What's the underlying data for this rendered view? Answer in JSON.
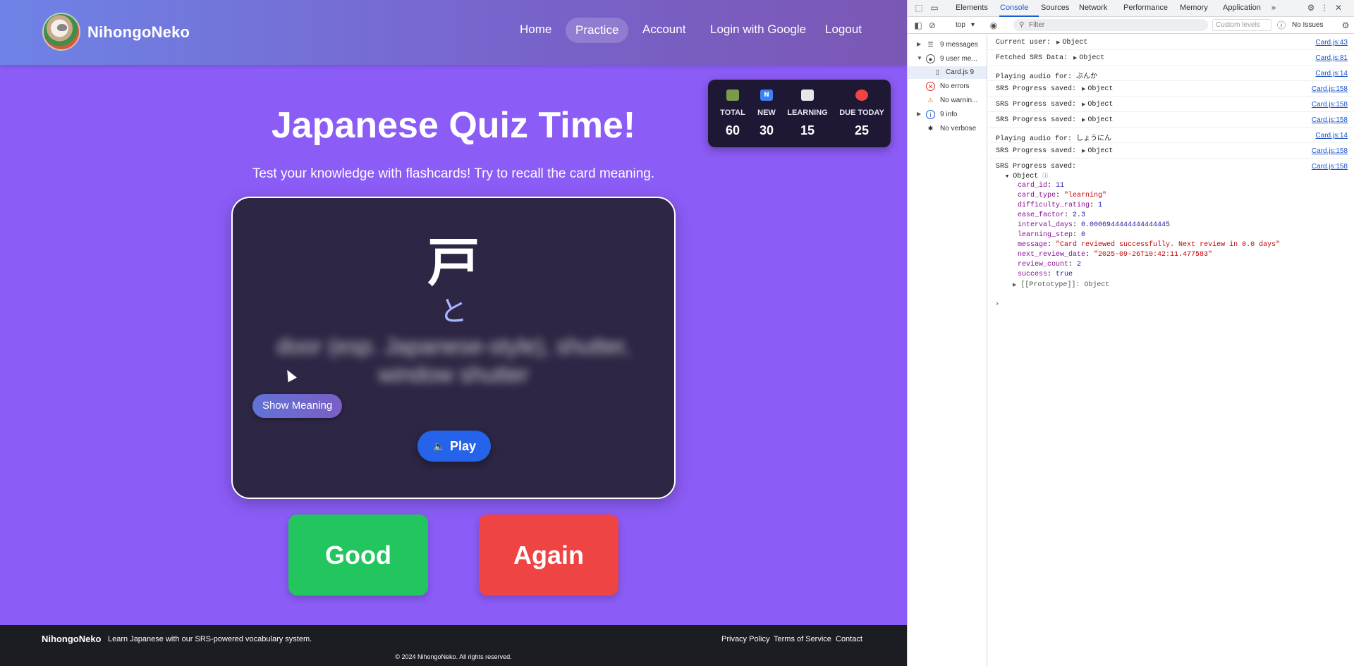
{
  "app": {
    "brand": "NihongoNeko",
    "nav": [
      "Home",
      "Practice",
      "Account",
      "Login with Google",
      "Logout"
    ],
    "active_nav": "Practice",
    "title": "Japanese Quiz Time!",
    "subtitle": "Test your knowledge with flashcards! Try to recall the card meaning.",
    "stats": [
      {
        "label": "TOTAL",
        "value": "60",
        "icon": "books-icon",
        "color": "#7c9b4a"
      },
      {
        "label": "NEW",
        "value": "30",
        "icon": "new-badge-icon",
        "color": "#3b82f6"
      },
      {
        "label": "LEARNING",
        "value": "15",
        "icon": "open-book-icon",
        "color": "#e5e7eb"
      },
      {
        "label": "DUE TODAY",
        "value": "25",
        "icon": "alarm-clock-icon",
        "color": "#ef4444"
      }
    ],
    "card": {
      "kanji": "戸",
      "kana": "と",
      "meaning": "door (esp. Japanese-style), shutter, window shutter",
      "show_meaning_label": "Show Meaning",
      "play_label": "Play"
    },
    "buttons": {
      "good": "Good",
      "again": "Again"
    },
    "colors": {
      "background": "#8b5cf6",
      "good": "#22c55e",
      "again": "#ef4444",
      "play": "#2563eb",
      "card": "#2d2644"
    },
    "footer": {
      "brand": "NihongoNeko",
      "tagline": "Learn Japanese with our SRS-powered vocabulary system.",
      "links": [
        "Privacy Policy",
        "Terms of Service",
        "Contact"
      ],
      "copyright": "© 2024 NihongoNeko. All rights reserved."
    }
  },
  "devtools": {
    "tabs": [
      "Elements",
      "Console",
      "Sources",
      "Network",
      "Performance",
      "Memory",
      "Application"
    ],
    "active_tab": "Console",
    "context": "top",
    "filter_placeholder": "Filter",
    "levels": "Custom levels",
    "issues": "No Issues",
    "sidebar": [
      {
        "label": "9 messages",
        "icon": "list-icon"
      },
      {
        "label": "9 user me...",
        "icon": "user-icon"
      },
      {
        "label": "Card.js  9",
        "icon": "file-icon"
      },
      {
        "label": "No errors",
        "icon": "error-icon"
      },
      {
        "label": "No warnin...",
        "icon": "warning-icon"
      },
      {
        "label": "9 info",
        "icon": "info-icon"
      },
      {
        "label": "No verbose",
        "icon": "bug-icon"
      }
    ],
    "logs": [
      {
        "text": "Current user:",
        "obj": "Object",
        "src": "Card.js:43"
      },
      {
        "text": "Fetched SRS Data:",
        "obj": "Object",
        "src": "Card.js:81"
      },
      {
        "text": "Playing audio for: ぶんか",
        "obj": "",
        "src": "Card.js:14"
      },
      {
        "text": "SRS Progress saved:",
        "obj": "Object",
        "src": "Card.js:158"
      },
      {
        "text": "SRS Progress saved:",
        "obj": "Object",
        "src": "Card.js:158"
      },
      {
        "text": "SRS Progress saved:",
        "obj": "Object",
        "src": "Card.js:158"
      },
      {
        "text": "Playing audio for: しょうにん",
        "obj": "",
        "src": "Card.js:14"
      },
      {
        "text": "SRS Progress saved:",
        "obj": "Object",
        "src": "Card.js:158"
      },
      {
        "text": "SRS Progress saved:",
        "obj": "",
        "src": "Card.js:158"
      }
    ],
    "expanded_object": {
      "header": "Object",
      "props": [
        {
          "key": "card_id",
          "value": "11",
          "type": "num"
        },
        {
          "key": "card_type",
          "value": "\"learning\"",
          "type": "str"
        },
        {
          "key": "difficulty_rating",
          "value": "1",
          "type": "num"
        },
        {
          "key": "ease_factor",
          "value": "2.3",
          "type": "num"
        },
        {
          "key": "interval_days",
          "value": "0.0006944444444444445",
          "type": "num"
        },
        {
          "key": "learning_step",
          "value": "0",
          "type": "num"
        },
        {
          "key": "message",
          "value": "\"Card reviewed successfully. Next review in 0.0 days\"",
          "type": "str"
        },
        {
          "key": "next_review_date",
          "value": "\"2025-09-26T10:42:11.477583\"",
          "type": "str"
        },
        {
          "key": "review_count",
          "value": "2",
          "type": "num"
        },
        {
          "key": "success",
          "value": "true",
          "type": "bool"
        }
      ],
      "prototype": "[[Prototype]]: Object"
    }
  }
}
